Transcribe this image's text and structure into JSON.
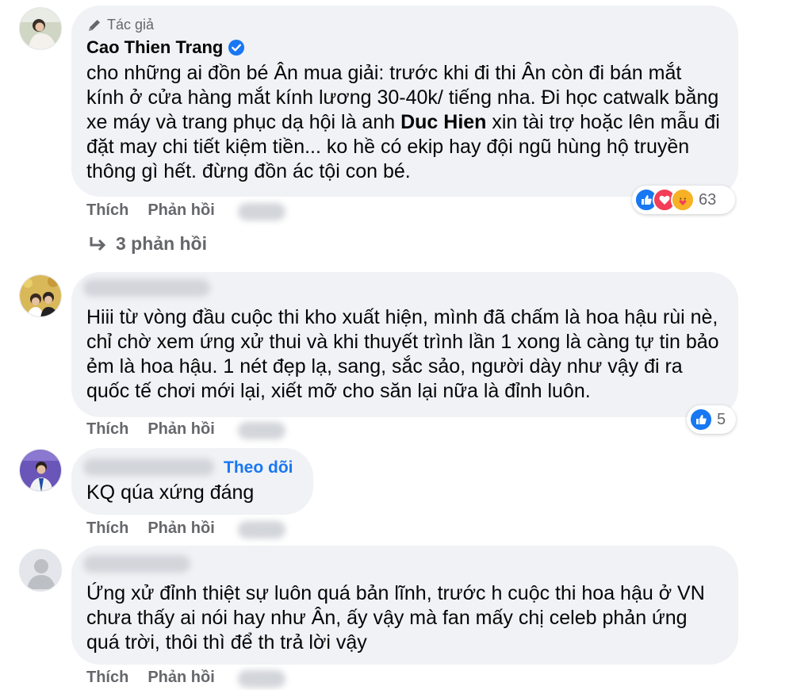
{
  "comments": [
    {
      "author_label": "Tác giả",
      "author_name": "Cao Thien Trang",
      "text_before": "cho những ai đồn bé Ân mua giải: trước khi đi thi Ân còn đi bán mắt kính ở cửa hàng mắt kính lương 30-40k/ tiếng nha. Đi học catwalk bằng xe máy và trang phục dạ hội là anh ",
      "mention": "Duc Hien",
      "text_after": " xin tài trợ hoặc lên mẫu đi đặt may chi tiết kiệm tiền... ko hề có ekip hay đội ngũ hùng hộ truyền thông gì hết. đừng đồn ác tội con bé.",
      "like": "Thích",
      "reply": "Phản hồi",
      "reaction_icons": [
        "like-icon",
        "love-icon",
        "care-icon"
      ],
      "reaction_count": "63",
      "replies_link": "3 phản hồi"
    },
    {
      "text": "Hiii từ vòng đầu cuộc thi kho xuất hiện, mình đã chấm là hoa hậu rùi nè, chỉ chờ xem ứng xử thui và khi thuyết trình lần 1 xong là càng tự tin bảo ẻm là hoa hậu. 1 nét đẹp lạ, sang, sắc sảo, người dày như vậy đi ra quốc tế chơi mới lại, xiết mỡ cho săn lại nữa là đỉnh luôn.",
      "like": "Thích",
      "reply": "Phản hồi",
      "reaction_icons": [
        "like-icon"
      ],
      "reaction_count": "5"
    },
    {
      "follow": "Theo dõi",
      "text": "KQ qúa xứng đáng",
      "like": "Thích",
      "reply": "Phản hồi"
    },
    {
      "text": "Ứng xử đỉnh thiệt sự luôn quá bản lĩnh, trước h cuộc thi hoa hậu ở VN chưa thấy ai nói hay như Ân, ấy vậy mà fan mấy chị celeb phản ứng quá trời, thôi thì để th trả lời vậy",
      "like": "Thích",
      "reply": "Phản hồi"
    }
  ],
  "colors": {
    "bubble": "#f0f2f5",
    "meta_text": "#65676b",
    "facebook_blue": "#1877f2",
    "love_red": "#f33e58",
    "care_yellow": "#f7b125"
  }
}
